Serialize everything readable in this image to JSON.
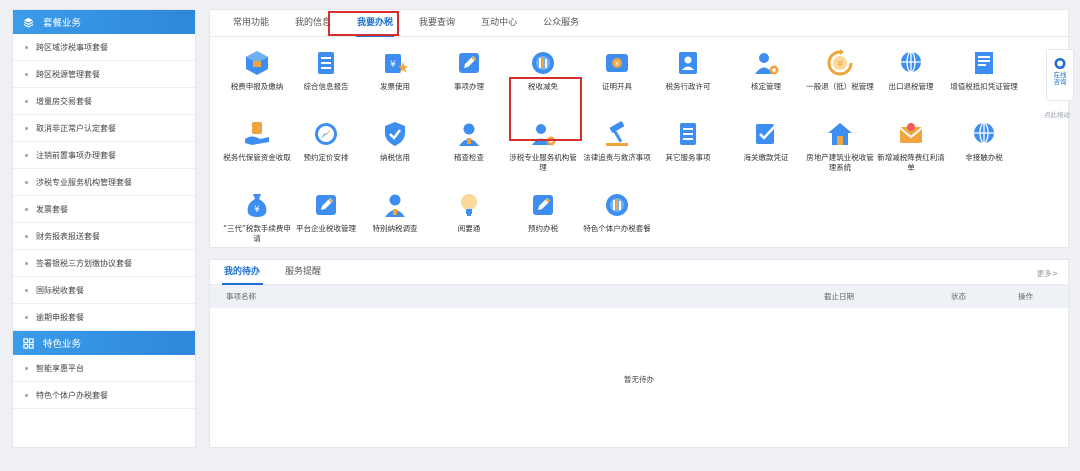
{
  "sidebar": {
    "section1_title": "套餐业务",
    "section1_items": [
      "跨区域涉税事项套餐",
      "跨区税源管理套餐",
      "增量房交易套餐",
      "取消非正常户认定套餐",
      "注销前置事项办理套餐",
      "涉税专业服务机构管理套餐",
      "发票套餐",
      "财务报表报送套餐",
      "签署银税三方划缴协议套餐",
      "国际税收套餐",
      "逾期申报套餐"
    ],
    "section2_title": "特色业务",
    "section2_items": [
      "智能享惠平台",
      "特色个体户办税套餐"
    ]
  },
  "tabs": [
    "常用功能",
    "我的信息",
    "我要办税",
    "我要查询",
    "互动中心",
    "公众服务"
  ],
  "active_tab": "我要办税",
  "functions": [
    {
      "label": "税费申报及缴纳",
      "icon": "cube-icon",
      "color": "#3d8ef0"
    },
    {
      "label": "综合信息报告",
      "icon": "document-list-icon",
      "color": "#3d8ef0"
    },
    {
      "label": "发票使用",
      "icon": "invoice-star-icon",
      "color": "#3d8ef0"
    },
    {
      "label": "事项办理",
      "icon": "edit-pen-icon",
      "color": "#3d8ef0"
    },
    {
      "label": "税收减免",
      "icon": "coins-icon",
      "color": "#3d8ef0"
    },
    {
      "label": "证明开具",
      "icon": "certificate-icon",
      "color": "#3d8ef0"
    },
    {
      "label": "税务行政许可",
      "icon": "id-card-icon",
      "color": "#3d8ef0"
    },
    {
      "label": "核定管理",
      "icon": "person-gear-icon",
      "color": "#3d8ef0"
    },
    {
      "label": "一般退（抵）税管理",
      "icon": "yen-refresh-icon",
      "color": "#f0a43d"
    },
    {
      "label": "出口退税管理",
      "icon": "globe-icon",
      "color": "#3d8ef0"
    },
    {
      "label": "增值税抵扣凭证管理",
      "icon": "receipt-icon",
      "color": "#3d8ef0"
    },
    {
      "label": "税务代保管资金收取",
      "icon": "hand-money-icon",
      "color": "#3d8ef0"
    },
    {
      "label": "预约定价安排",
      "icon": "compass-icon",
      "color": "#3d8ef0"
    },
    {
      "label": "纳税信用",
      "icon": "shield-check-icon",
      "color": "#3d8ef0"
    },
    {
      "label": "稽查检查",
      "icon": "person-icon",
      "color": "#3d8ef0"
    },
    {
      "label": "涉税专业服务机构管理",
      "icon": "agent-gear-icon",
      "color": "#3d8ef0"
    },
    {
      "label": "法律追责与救济事项",
      "icon": "gavel-icon",
      "color": "#3d8ef0"
    },
    {
      "label": "其它服务事项",
      "icon": "list-doc-icon",
      "color": "#3d8ef0"
    },
    {
      "label": "海关缴款凭证",
      "icon": "check-doc-icon",
      "color": "#3d8ef0"
    },
    {
      "label": "房地产建筑业税收管理系统",
      "icon": "house-icon",
      "color": "#3d8ef0"
    },
    {
      "label": "新增减税降费红利清单",
      "icon": "envelope-icon",
      "color": "#f0a43d"
    },
    {
      "label": "非接触办税",
      "icon": "globe-hand-icon",
      "color": "#3d8ef0"
    },
    {
      "label": "“三代”税款手续费申请",
      "icon": "money-bag-icon",
      "color": "#3d8ef0"
    },
    {
      "label": "平台企业税收管理",
      "icon": "edit-box-icon",
      "color": "#3d8ef0"
    },
    {
      "label": "特别纳税调查",
      "icon": "people-icon",
      "color": "#3d8ef0"
    },
    {
      "label": "阅要通",
      "icon": "lightbulb-icon",
      "color": "#3d8ef0"
    },
    {
      "label": "预约办税",
      "icon": "pencil-doc-icon",
      "color": "#3d8ef0"
    },
    {
      "label": "特色个体户办税套餐",
      "icon": "coin-stack-icon",
      "color": "#3d8ef0"
    }
  ],
  "pending": {
    "tabs": [
      "我的待办",
      "服务提醒"
    ],
    "more": "更多>",
    "columns": [
      "事项名称",
      "截止日期",
      "状态",
      "操作"
    ],
    "empty_text": "暂无待办"
  },
  "float_help": {
    "line1": "在线",
    "line2": "咨询",
    "drag_hint": "点此拖动"
  }
}
